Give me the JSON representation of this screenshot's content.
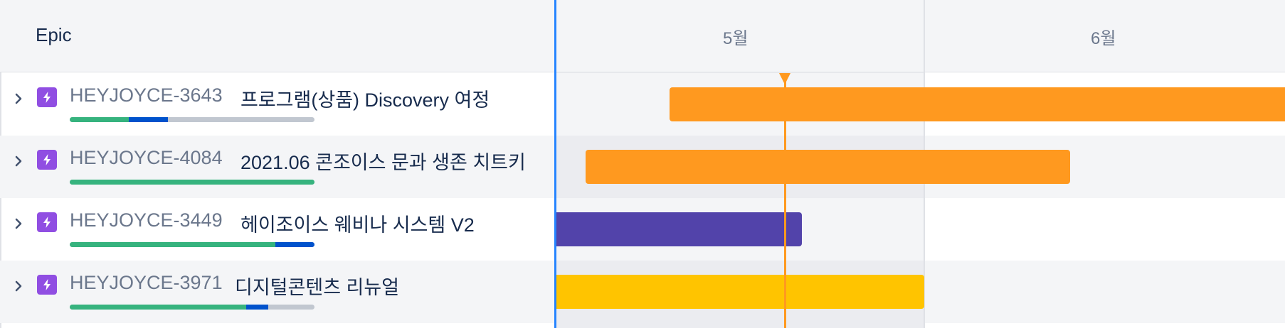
{
  "header": {
    "title": "Epic"
  },
  "months": [
    "5월",
    "6월"
  ],
  "epics": [
    {
      "key": "HEYJOYCE-3643",
      "title": "프로그램(상품) Discovery 여정",
      "progress": {
        "done": 0.24,
        "in_progress": 0.16
      },
      "bar_color": "#ff991f",
      "bar_range": {
        "start": 0.155,
        "end": 1.0
      }
    },
    {
      "key": "HEYJOYCE-4084",
      "title": "2021.06 콘조이스 문과 생존 치트키",
      "progress": {
        "done": 1.0,
        "in_progress": 0.0
      },
      "bar_color": "#ff991f",
      "bar_range": {
        "start": 0.04,
        "end": 0.705
      }
    },
    {
      "key": "HEYJOYCE-3449",
      "title": "헤이조이스 웨비나 시스템 V2",
      "progress": {
        "done": 0.84,
        "in_progress": 0.16
      },
      "bar_color": "#5243aa",
      "bar_range": {
        "start": 0.0,
        "end": 0.337
      }
    },
    {
      "key": "HEYJOYCE-3971",
      "title": "디지털콘텐츠 리뉴얼",
      "progress": {
        "done": 0.72,
        "in_progress": 0.09
      },
      "bar_color": "#ffc400",
      "bar_range": {
        "start": 0.0,
        "end": 0.505
      }
    }
  ],
  "colors": {
    "today": "#ff991f",
    "done": "#36b37e",
    "in_progress": "#0052cc",
    "epic_icon": "#904ee2",
    "divider": "#2684ff"
  },
  "today_position": 0.313
}
